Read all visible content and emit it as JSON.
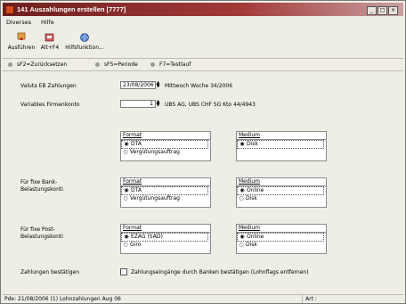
{
  "window": {
    "title": "141 Auszahlungen erstellen [7777]"
  },
  "menu": [
    "Diverses",
    "Hilfe"
  ],
  "toolbar": [
    {
      "label": "Ausführen",
      "icon": "run-icon"
    },
    {
      "label": "Alt+F4",
      "icon": "exit-icon"
    },
    {
      "label": "Hilfsfunktion...",
      "icon": "help-globe-icon"
    }
  ],
  "fkeys": [
    "sF2=Zurücksetzen",
    "sF5=Periode",
    "F7=Testlauf"
  ],
  "form": {
    "valuta_label": "Valuta EB Zahlungen",
    "valuta_value": "23/08/2006",
    "valuta_info": "Mittwoch Woche 34/2006",
    "konto_label": "Variables Firmenkonto",
    "konto_value": "1",
    "konto_info": "UBS AG, UBS CHF SG Kto 44/4943",
    "group1": {
      "label": "",
      "format": {
        "header": "Format",
        "options": [
          "DTA",
          "Vergütungsauftrag"
        ],
        "selected": 0
      },
      "medium": {
        "header": "Medium",
        "options": [
          "Disk"
        ],
        "selected": 0
      }
    },
    "group2": {
      "label_line1": "Für fixe Bank-",
      "label_line2": "Belastungskonti",
      "format": {
        "header": "Format",
        "options": [
          "DTA",
          "Vergütungsauftrag"
        ],
        "selected": 0
      },
      "medium": {
        "header": "Medium",
        "options": [
          "Online",
          "Disk"
        ],
        "selected": 0
      }
    },
    "group3": {
      "label_line1": "Für fixe Post-",
      "label_line2": "Belastungskonti",
      "format": {
        "header": "Format",
        "options": [
          "EZAG (SAD)",
          "Giro"
        ],
        "selected": 0
      },
      "medium": {
        "header": "Medium",
        "options": [
          "Online",
          "Disk"
        ],
        "selected": 0
      }
    },
    "confirm_label": "Zahlungen bestätigen",
    "confirm_checkbox_text": "Zahlungseingänge durch Banken bestätigen (Lohnflags entfernen)"
  },
  "status": {
    "left": "Pde: 21/08/2006 (1) Lohnzahlungen Aug 06",
    "right": "Art :"
  },
  "colors": {
    "title_start": "#6e1f1f",
    "title_end": "#c9a0a0",
    "window_bg": "#efeee6"
  }
}
